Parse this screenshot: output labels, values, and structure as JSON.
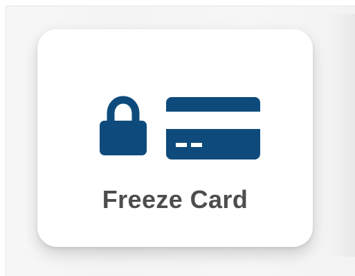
{
  "freeze_card": {
    "label": "Freeze Card",
    "icons": [
      "lock-icon",
      "credit-card-icon"
    ]
  },
  "colors": {
    "icon": "#0e4b7c",
    "label": "#4d4d4d",
    "card_background": "#ffffff",
    "panel_background": "#f5f5f5"
  }
}
